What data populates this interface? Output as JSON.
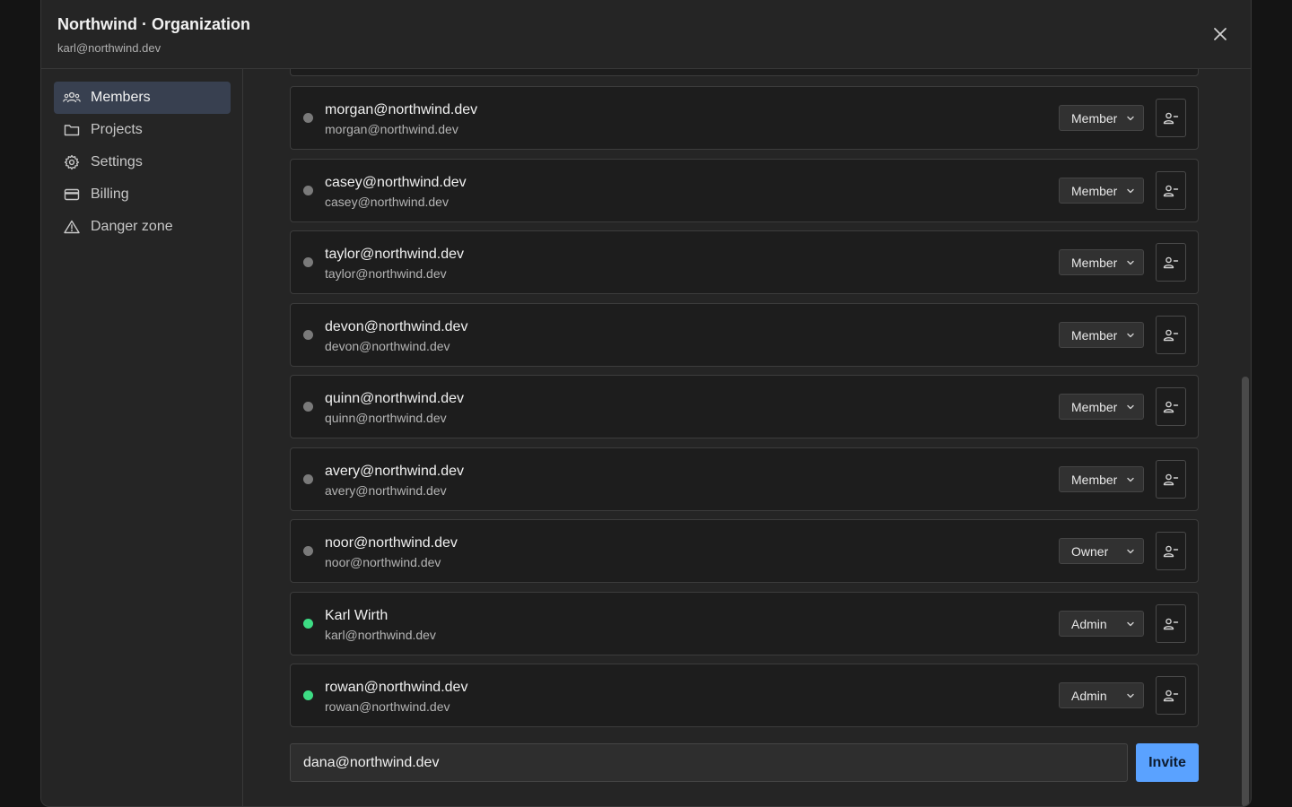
{
  "header": {
    "title": "Northwind · Organization",
    "subtitle": "karl@northwind.dev",
    "close_icon": "close-icon"
  },
  "sidebar": {
    "items": [
      {
        "label": "Members",
        "icon": "members-icon",
        "active": true
      },
      {
        "label": "Projects",
        "icon": "folder-icon",
        "active": false
      },
      {
        "label": "Settings",
        "icon": "gear-icon",
        "active": false
      },
      {
        "label": "Billing",
        "icon": "credit-card-icon",
        "active": false
      },
      {
        "label": "Danger zone",
        "icon": "warning-icon",
        "active": false
      }
    ]
  },
  "members": [
    {
      "name": "morgan@northwind.dev",
      "email": "morgan@northwind.dev",
      "role": "Member",
      "online": false
    },
    {
      "name": "casey@northwind.dev",
      "email": "casey@northwind.dev",
      "role": "Member",
      "online": false
    },
    {
      "name": "taylor@northwind.dev",
      "email": "taylor@northwind.dev",
      "role": "Member",
      "online": false
    },
    {
      "name": "devon@northwind.dev",
      "email": "devon@northwind.dev",
      "role": "Member",
      "online": false
    },
    {
      "name": "quinn@northwind.dev",
      "email": "quinn@northwind.dev",
      "role": "Member",
      "online": false
    },
    {
      "name": "avery@northwind.dev",
      "email": "avery@northwind.dev",
      "role": "Member",
      "online": false
    },
    {
      "name": "noor@northwind.dev",
      "email": "noor@northwind.dev",
      "role": "Owner",
      "online": false
    },
    {
      "name": "Karl Wirth",
      "email": "karl@northwind.dev",
      "role": "Admin",
      "online": true
    },
    {
      "name": "rowan@northwind.dev",
      "email": "rowan@northwind.dev",
      "role": "Admin",
      "online": true
    }
  ],
  "invite": {
    "input_value": "dana@northwind.dev",
    "button_label": "Invite"
  },
  "colors": {
    "accent": "#5aa2ff",
    "online": "#3ddc84",
    "offline": "#7a7a7a"
  }
}
